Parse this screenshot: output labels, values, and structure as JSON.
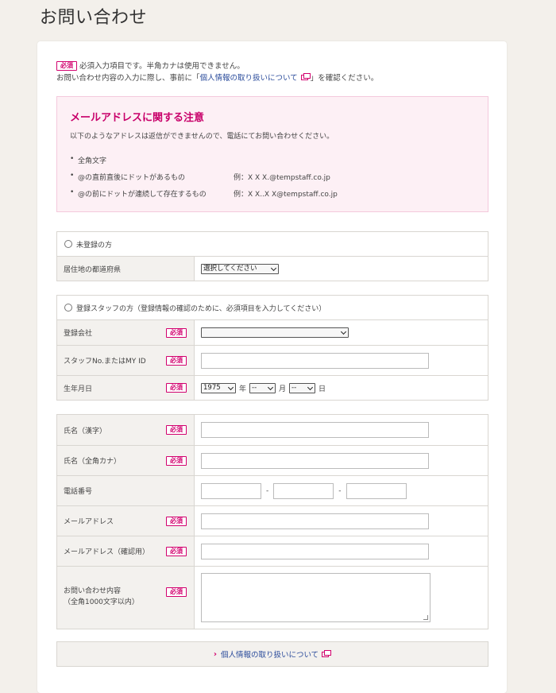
{
  "page": {
    "title": "お問い合わせ"
  },
  "required_label": "必須",
  "intro": {
    "line1": "必須入力項目です。半角カナは使用できません。",
    "line2_prefix": "お問い合わせ内容の入力に際し、事前に「",
    "line2_link": "個人情報の取り扱いについて",
    "line2_suffix": "」を確認ください。"
  },
  "notice": {
    "title": "メールアドレスに関する注意",
    "description": "以下のようなアドレスは返信ができませんので、電話にてお問い合わせください。",
    "items": [
      {
        "text": "全角文字",
        "example": ""
      },
      {
        "text": "@の直前直後にドットがあるもの",
        "example": "例：X X X.@tempstaff.co.jp"
      },
      {
        "text": "@の前にドットが連続して存在するもの",
        "example": "例：X X..X X@tempstaff.co.jp"
      }
    ]
  },
  "unregistered": {
    "radio_label": "未登録の方",
    "prefecture_label": "居住地の都道府県",
    "prefecture_value": "選択してください"
  },
  "registered": {
    "radio_label": "登録スタッフの方（登録情報の確認のために、必須項目を入力してください）",
    "company_label": "登録会社",
    "company_value": "",
    "staff_label": "スタッフNo.またはMY ID",
    "birth_label": "生年月日",
    "birth_year": "1975",
    "year_unit": "年",
    "birth_month": "--",
    "month_unit": "月",
    "birth_day": "--",
    "day_unit": "日"
  },
  "contact": {
    "name_kanji": "氏名（漢字）",
    "name_kana": "氏名（全角カナ）",
    "phone": "電話番号",
    "phone_sep": "-",
    "email": "メールアドレス",
    "email_confirm": "メールアドレス（確認用）",
    "inquiry_line1": "お問い合わせ内容",
    "inquiry_line2": "（全角1000文字以内）"
  },
  "privacy_link": "個人情報の取り扱いについて"
}
